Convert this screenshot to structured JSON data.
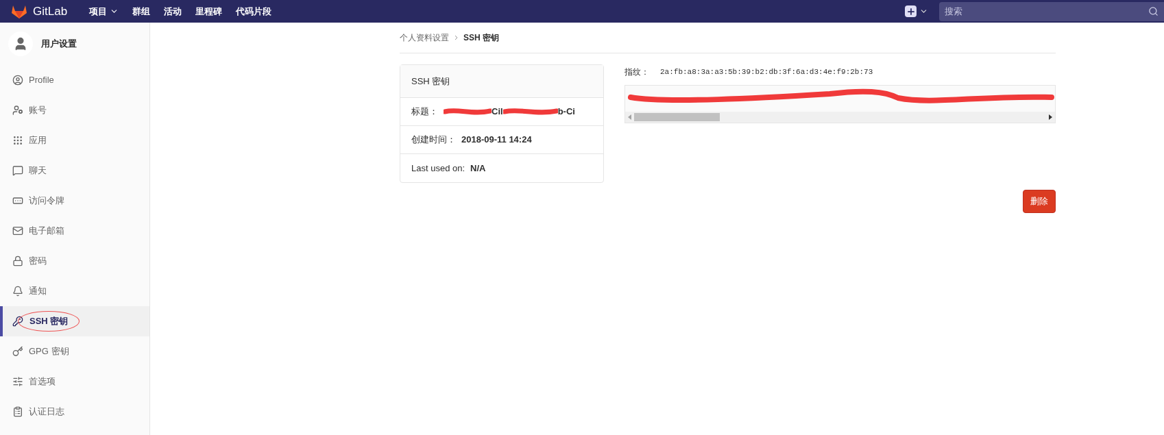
{
  "navbar": {
    "brand": "GitLab",
    "links": [
      {
        "label": "项目",
        "dropdown": true
      },
      {
        "label": "群组",
        "dropdown": false
      },
      {
        "label": "活动",
        "dropdown": false
      },
      {
        "label": "里程碑",
        "dropdown": false
      },
      {
        "label": "代码片段",
        "dropdown": false
      }
    ],
    "search": {
      "placeholder": "搜索"
    }
  },
  "sidebar": {
    "title": "用户设置",
    "items": [
      {
        "label": "Profile",
        "kind": "profile",
        "selected": false
      },
      {
        "label": "账号",
        "kind": "account",
        "selected": false
      },
      {
        "label": "应用",
        "kind": "apps",
        "selected": false
      },
      {
        "label": "聊天",
        "kind": "chat",
        "selected": false
      },
      {
        "label": "访问令牌",
        "kind": "token",
        "selected": false
      },
      {
        "label": "电子邮箱",
        "kind": "mail",
        "selected": false
      },
      {
        "label": "密码",
        "kind": "lock",
        "selected": false
      },
      {
        "label": "通知",
        "kind": "bell",
        "selected": false
      },
      {
        "label": "SSH 密钥",
        "kind": "key",
        "selected": true
      },
      {
        "label": "GPG 密钥",
        "kind": "key2",
        "selected": false
      },
      {
        "label": "首选项",
        "kind": "sliders",
        "selected": false
      },
      {
        "label": "认证日志",
        "kind": "log",
        "selected": false
      }
    ]
  },
  "breadcrumb": [
    "个人资料设置",
    "SSH 密钥"
  ],
  "key_card": {
    "header": "SSH 密钥",
    "rows": [
      {
        "label": "标题：",
        "value_parts": [
          "Cil",
          "b-Ci"
        ],
        "redacted": true
      },
      {
        "label": "创建时间：",
        "value_parts": [
          "2018-09-11 14:24"
        ]
      },
      {
        "label": "Last used on:",
        "value_parts": [
          "N/A"
        ]
      }
    ]
  },
  "fingerprint": {
    "label": "指纹：",
    "value": "2a:fb:a8:3a:a3:5b:39:b2:db:3f:6a:d3:4e:f9:2b:73"
  },
  "delete_button": "删除"
}
